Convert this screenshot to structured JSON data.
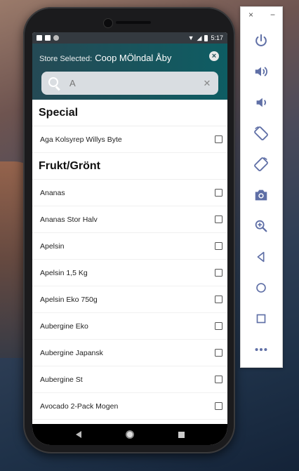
{
  "status_bar": {
    "time": "5:17"
  },
  "header": {
    "store_label": "Store Selected:",
    "store_name": "Coop MÖlndal Åby",
    "close_symbol": "×"
  },
  "search": {
    "value": "",
    "placeholder": "A",
    "clear_symbol": "✕"
  },
  "sections": [
    {
      "title": "Special",
      "items": [
        "Aga Kolsyrep Willys Byte"
      ]
    },
    {
      "title": "Frukt/Grönt",
      "items": [
        "Ananas",
        "Ananas Stor Halv",
        "Apelsin",
        "Apelsin 1,5 Kg",
        "Apelsin Eko 750g",
        "Aubergine Eko",
        "Aubergine Japansk",
        "Aubergine St",
        "Avocado 2-Pack Mogen"
      ]
    }
  ],
  "emulator_panel": {
    "close_symbol": "×",
    "minimize_symbol": "−",
    "tools": [
      "power-icon",
      "volume-up-icon",
      "volume-down-icon",
      "rotate-left-icon",
      "rotate-right-icon",
      "camera-icon",
      "zoom-icon",
      "back-icon",
      "home-icon",
      "overview-icon",
      "more-icon"
    ]
  },
  "colors": {
    "header_start": "#254a55",
    "header_end": "#0e5d63",
    "emulator_icon": "#5f6fa6"
  }
}
